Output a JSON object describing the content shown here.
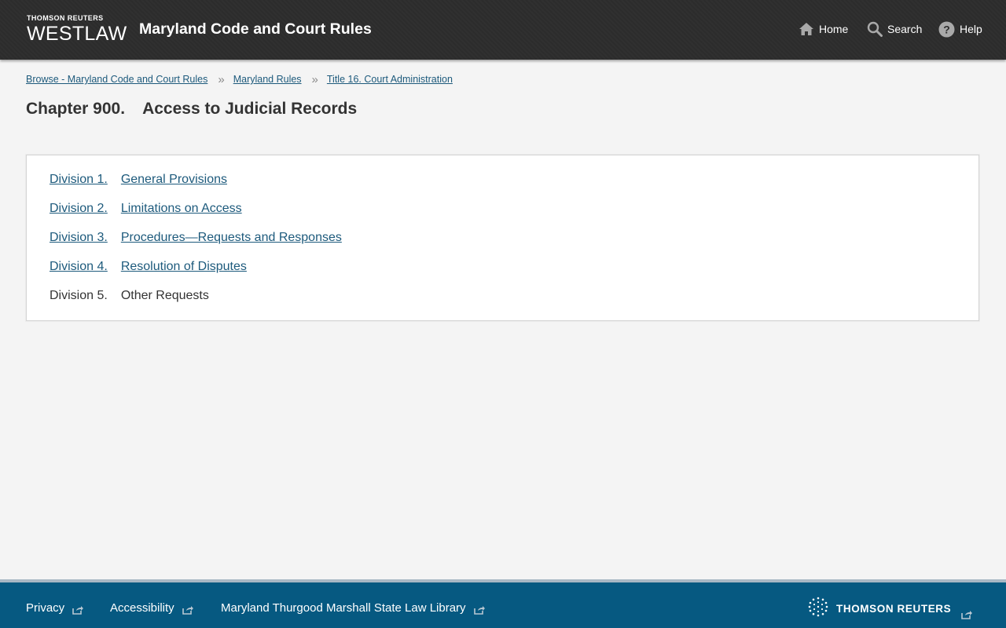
{
  "header": {
    "logo_top": "THOMSON REUTERS",
    "logo_main": "WESTLAW",
    "site_title": "Maryland Code and Court Rules",
    "nav": [
      {
        "label": "Home",
        "icon": "home-icon"
      },
      {
        "label": "Search",
        "icon": "search-icon"
      },
      {
        "label": "Help",
        "icon": "help-icon"
      }
    ]
  },
  "breadcrumb": [
    {
      "label": "Browse - Maryland Code and Court Rules"
    },
    {
      "label": "Maryland Rules"
    },
    {
      "label": "Title 16. Court Administration"
    }
  ],
  "page": {
    "chapter_num": "Chapter 900.",
    "chapter_title": "Access to Judicial Records"
  },
  "divisions": [
    {
      "num": "Division 1.",
      "title": "General Provisions",
      "link": true
    },
    {
      "num": "Division 2.",
      "title": "Limitations on Access",
      "link": true
    },
    {
      "num": "Division 3.",
      "title": "Procedures—Requests and Responses",
      "link": true
    },
    {
      "num": "Division 4.",
      "title": "Resolution of Disputes",
      "link": true
    },
    {
      "num": "Division 5.",
      "title": "Other Requests",
      "link": false
    }
  ],
  "footer": {
    "links": [
      {
        "label": "Privacy"
      },
      {
        "label": "Accessibility"
      },
      {
        "label": "Maryland Thurgood Marshall State Law Library"
      }
    ],
    "brand": "THOMSON REUTERS"
  },
  "colors": {
    "header_bg": "#2d2d2d",
    "link": "#1d5a7c",
    "footer_bg": "#065981",
    "page_bg": "#f4f4f4"
  }
}
